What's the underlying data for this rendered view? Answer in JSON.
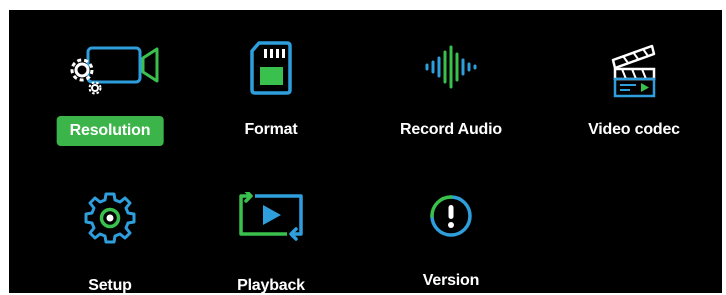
{
  "colors": {
    "accent_green": "#3ac04c",
    "accent_blue": "#2e9fdc",
    "background": "#000000",
    "text": "#ffffff",
    "selected_bg": "#3bb54a"
  },
  "menu": {
    "selected": "Resolution",
    "items": [
      {
        "id": "resolution",
        "label": "Resolution",
        "icon": "camera-settings-icon"
      },
      {
        "id": "format",
        "label": "Format",
        "icon": "sd-card-icon"
      },
      {
        "id": "record_audio",
        "label": "Record Audio",
        "icon": "audio-waveform-icon"
      },
      {
        "id": "video_codec",
        "label": "Video codec",
        "icon": "clapperboard-icon"
      },
      {
        "id": "setup",
        "label": "Setup",
        "icon": "gear-icon"
      },
      {
        "id": "playback",
        "label": "Playback",
        "icon": "playback-icon"
      },
      {
        "id": "version",
        "label": "Version",
        "icon": "info-exclamation-icon"
      }
    ]
  }
}
